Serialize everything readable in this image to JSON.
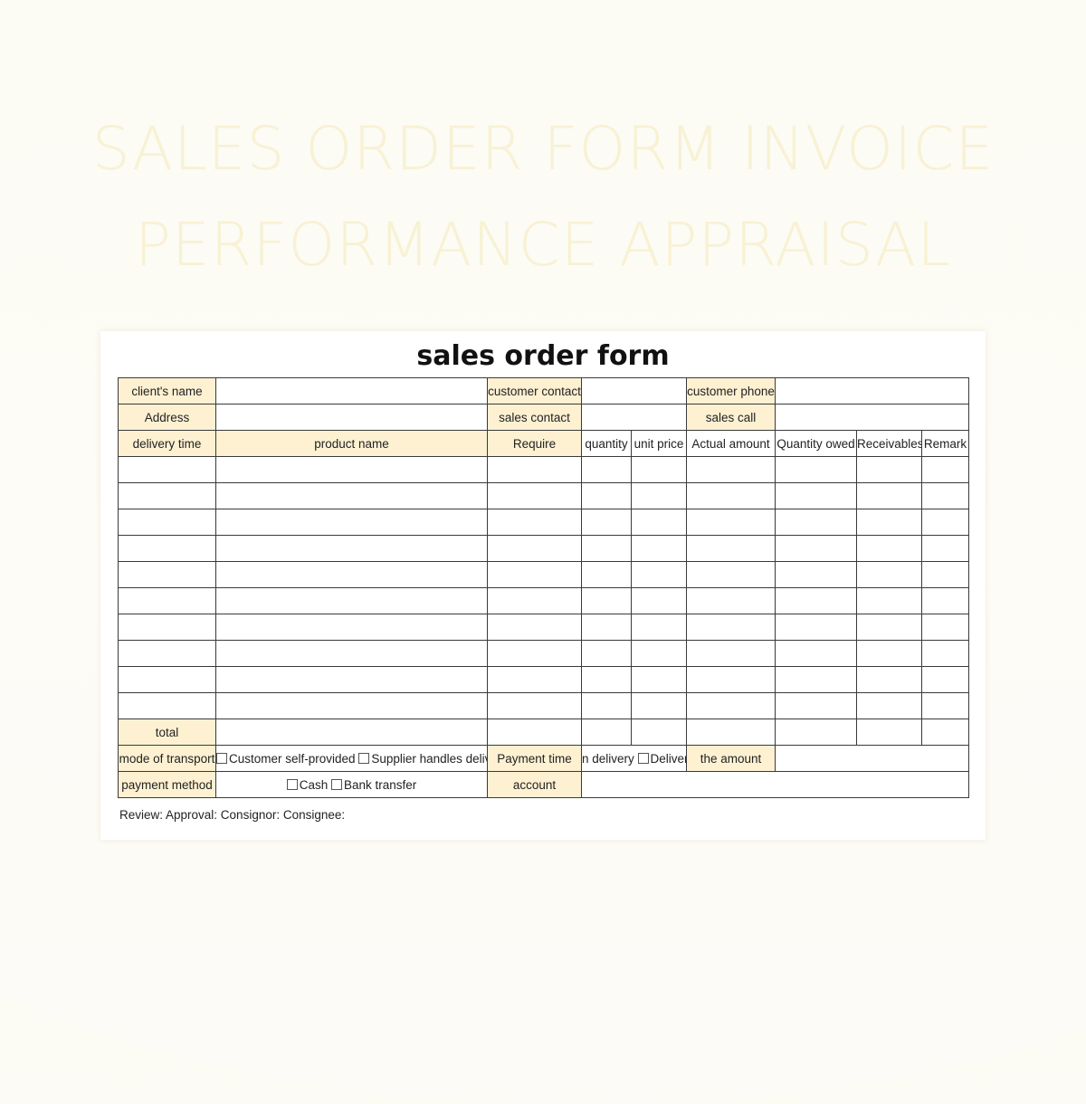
{
  "hero": {
    "line1": "SALES ORDER FORM INVOICE",
    "line2": "PERFORMANCE APPRAISAL"
  },
  "form": {
    "title": "sales order form",
    "info_rows": {
      "clients_name": "client's name",
      "customer_contact": "customer contact",
      "customer_phone": "customer phone",
      "address": "Address",
      "sales_contact": "sales contact",
      "sales_call": "sales call"
    },
    "columns": [
      "delivery time",
      "product name",
      "Require",
      "quantity",
      "unit price",
      "Actual amount",
      "Quantity owed",
      "Receivables",
      "Remark"
    ],
    "empty_item_rows": 10,
    "total_label": "total",
    "transport": {
      "label": "mode of transport",
      "option1": "Customer self-provided",
      "option2": "Supplier handles deliver",
      "payment_time_label": "Payment time",
      "payment_time_value": "n delivery",
      "payment_time_option": "Delivery",
      "amount_label": "the amount"
    },
    "payment": {
      "label": "payment method",
      "option1": "Cash",
      "option2": "Bank transfer",
      "account_label": "account"
    },
    "footer": "Review: Approval: Consignor: Consignee:"
  },
  "colors": {
    "label_fill": "#fdf1d2",
    "hero_text": "#f8f1d3",
    "border": "#3a3a3a"
  }
}
